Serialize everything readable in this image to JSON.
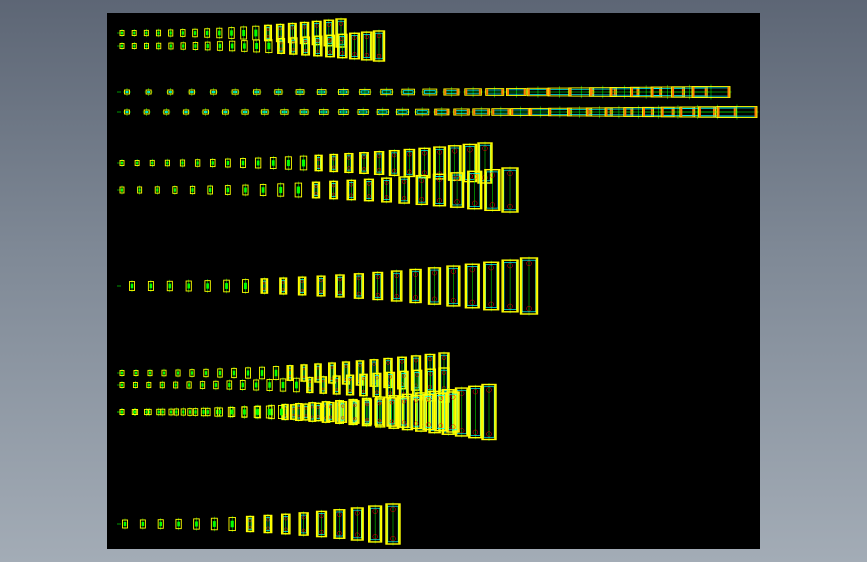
{
  "colors": {
    "canvas": "#000000",
    "outline": "#ffff00",
    "inner": "#00ffff",
    "centerline": "#00ff00",
    "detail": "#ff0000",
    "marker": "#ff7f00",
    "label": "#c8c8c8"
  },
  "drawing": {
    "rows": [
      {
        "label": "",
        "orientation": "vertical",
        "count": 19
      },
      {
        "label": "",
        "orientation": "vertical",
        "count": 22
      },
      {
        "label": "",
        "orientation": "horizontal",
        "count": 28
      },
      {
        "label": "",
        "orientation": "horizontal",
        "count": 32
      },
      {
        "label": "",
        "orientation": "vertical",
        "count": 25
      },
      {
        "label": "",
        "orientation": "vertical",
        "count": 23
      },
      {
        "label": "",
        "orientation": "vertical",
        "count": 22
      },
      {
        "label": "",
        "orientation": "vertical",
        "count": 24
      },
      {
        "label": "",
        "orientation": "vertical",
        "count": 25
      },
      {
        "label": "",
        "orientation": "vertical",
        "count": 28
      },
      {
        "label": "",
        "orientation": "vertical",
        "count": 28
      },
      {
        "label": "",
        "orientation": "vertical",
        "count": 16
      }
    ]
  }
}
